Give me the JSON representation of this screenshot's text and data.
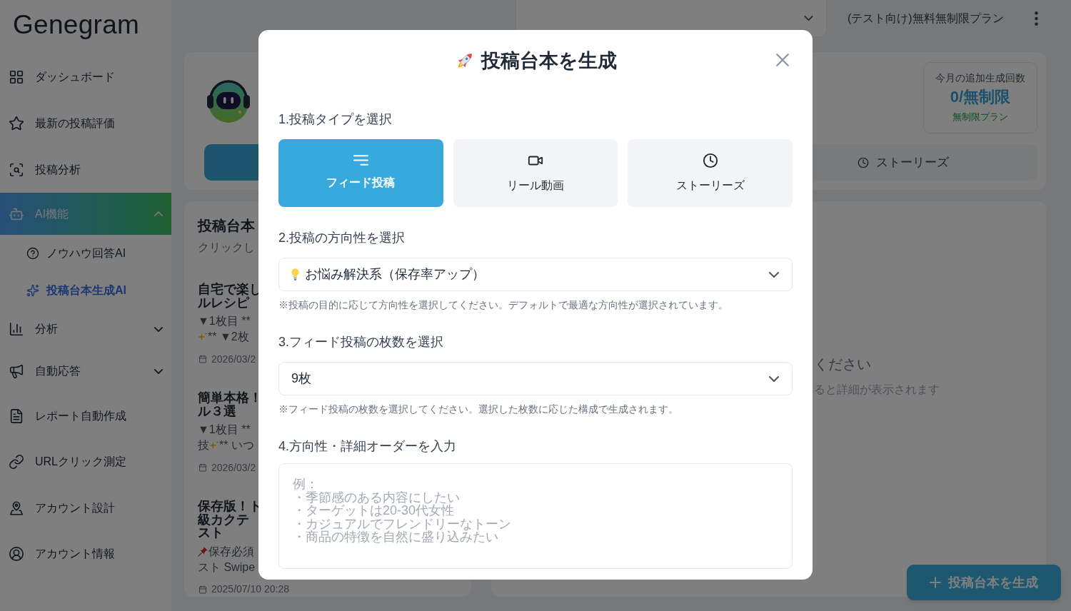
{
  "sidebar": {
    "logo": "Genegram",
    "items": [
      {
        "kind": "link",
        "label": "ダッシュボード",
        "selected": false
      },
      {
        "kind": "link",
        "label": "最新の投稿評価",
        "selected": false
      },
      {
        "kind": "link",
        "label": "投稿分析",
        "selected": false
      },
      {
        "kind": "group",
        "label": "AI機能",
        "selected": true,
        "expanded": true,
        "children": [
          {
            "label": "ノウハウ回答AI",
            "selected": false
          },
          {
            "label": "投稿台本生成AI",
            "selected": true
          }
        ]
      },
      {
        "kind": "group",
        "label": "分析",
        "selected": false,
        "expanded": false
      },
      {
        "kind": "group",
        "label": "自動応答",
        "selected": false,
        "expanded": false
      },
      {
        "kind": "link",
        "label": "レポート自動作成",
        "selected": false
      },
      {
        "kind": "link",
        "label": "URLクリック測定",
        "selected": false
      },
      {
        "kind": "link",
        "label": "アカウント設計",
        "selected": false
      },
      {
        "kind": "link",
        "label": "アカウント情報",
        "selected": false
      }
    ]
  },
  "top_bar": {
    "plan": "(テスト向け)無料無制限プラン"
  },
  "header_card": {
    "type_tabs": [
      {
        "selected": true
      },
      {
        "label": "ストーリーズ",
        "selected": false
      }
    ],
    "quota": {
      "label": "今月の追加生成回数",
      "value": "0/無制限",
      "plan": "無制限プラン"
    }
  },
  "scripts_card": {
    "title": "投稿台本",
    "subtitle": "クリックし",
    "items": [
      {
        "title_lines": [
          "自宅で楽し",
          "ルレシピ"
        ],
        "excerpt_lines": [
          [
            {
              "kind": "text",
              "text": "▼1枚目 **"
            }
          ],
          [
            {
              "kind": "sparkle"
            },
            {
              "kind": "text",
              "text": "** ▼2枚"
            }
          ]
        ],
        "date": "2026/03/2"
      },
      {
        "title_lines": [
          "簡単本格！",
          "ル３選"
        ],
        "excerpt_lines": [
          [
            {
              "kind": "text",
              "text": "▼1枚目 **"
            }
          ],
          [
            {
              "kind": "text",
              "text": "技"
            },
            {
              "kind": "sparkle"
            },
            {
              "kind": "text",
              "text": "** いつ"
            }
          ]
        ],
        "date": "2026/03/2"
      },
      {
        "title_lines": [
          "保存版！ト",
          "級カクテ",
          "スト"
        ],
        "excerpt_lines": [
          [
            {
              "kind": "pin"
            },
            {
              "kind": "text",
              "text": "保存必須"
            }
          ],
          [
            {
              "kind": "text",
              "text": "スト Swipe"
            }
          ]
        ],
        "date": "2025/07/10 20:28"
      }
    ]
  },
  "detail_card": {
    "message": "ください",
    "hint": "ると詳細が表示されます"
  },
  "fab": {
    "label": "投稿台本を生成"
  },
  "modal": {
    "title": "投稿台本を生成",
    "sections": [
      {
        "kind": "types",
        "label": "1.投稿タイプを選択",
        "options": [
          {
            "label": "フィード投稿",
            "selected": true
          },
          {
            "label": "リール動画",
            "selected": false
          },
          {
            "label": "ストーリーズ",
            "selected": false
          }
        ]
      },
      {
        "kind": "direction",
        "label": "2.投稿の方向性を選択",
        "value": "お悩み解決系（保存率アップ）",
        "note": "※投稿の目的に応じて方向性を選択してください。デフォルトで最適な方向性が選択されています。"
      },
      {
        "kind": "count",
        "label": "3.フィード投稿の枚数を選択",
        "value": "9枚",
        "note": "※フィード投稿の枚数を選択してください。選択した枚数に応じた構成で生成されます。"
      },
      {
        "kind": "text",
        "label": "4.方向性・詳細オーダーを入力",
        "placeholder": [
          "例：",
          "・季節感のある内容にしたい",
          "・ターゲットは20-30代女性",
          "・カジュアルでフレンドリーなトーン",
          "・商品の特徴を自然に盛り込みたい"
        ]
      }
    ]
  }
}
